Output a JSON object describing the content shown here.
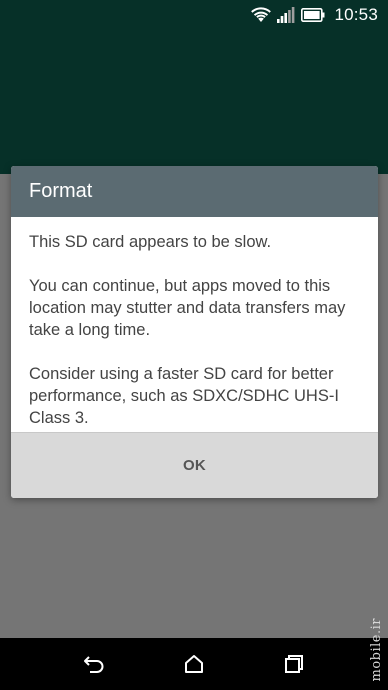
{
  "status_bar": {
    "time": "10:53",
    "icons": [
      "wifi-icon",
      "signal-icon",
      "battery-icon"
    ]
  },
  "dialog": {
    "title": "Format",
    "paragraphs": [
      "This SD card appears to be slow.",
      "You can continue, but apps moved to this location may stutter and data transfers may take a long time.",
      "Consider using a faster SD card for better performance, such as SDXC/SDHC UHS-I Class 3."
    ],
    "ok_label": "OK"
  },
  "nav_bar": {
    "icons": [
      "back-icon",
      "home-icon",
      "recents-icon"
    ]
  },
  "watermark": "mobile.ir",
  "colors": {
    "header": "#063028",
    "dim_background": "#757575",
    "dialog_title_bar": "#5b6b72",
    "dialog_actions": "#d9d9d9",
    "nav_bar": "#000000"
  }
}
